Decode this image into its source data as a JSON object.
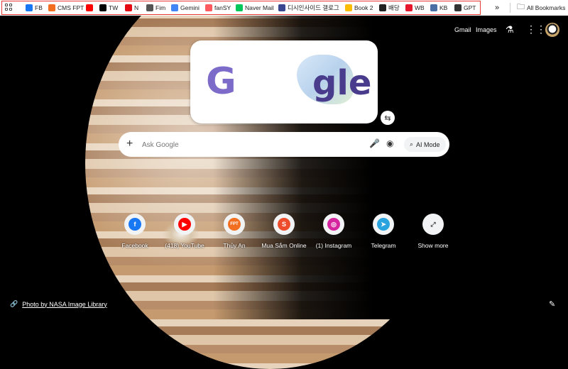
{
  "bookmarks": [
    {
      "label": "FB",
      "icon": "facebook-icon",
      "color": "#1877f2"
    },
    {
      "label": "CMS FPT",
      "icon": "fpt-icon",
      "color": "#f26f21"
    },
    {
      "label": "",
      "icon": "youtube-icon",
      "color": "#ff0000"
    },
    {
      "label": "TW",
      "icon": "x-icon",
      "color": "#000000"
    },
    {
      "label": "N",
      "icon": "netflix-icon",
      "color": "#e50914"
    },
    {
      "label": "Fim",
      "icon": "globe-icon",
      "color": "#555555"
    },
    {
      "label": "Gemini",
      "icon": "gemini-icon",
      "color": "#4285f4"
    },
    {
      "label": "fanSY",
      "icon": "fansy-icon",
      "color": "#ff5a5f"
    },
    {
      "label": "Naver Mail",
      "icon": "naver-icon",
      "color": "#03c75a"
    },
    {
      "label": "디시인사이드 갤로그",
      "icon": "dc-icon",
      "color": "#3b4890"
    },
    {
      "label": "Book 2",
      "icon": "drive-icon",
      "color": "#fbbc04"
    },
    {
      "label": "배당",
      "icon": "shield-icon",
      "color": "#222222"
    },
    {
      "label": "WB",
      "icon": "weibo-icon",
      "color": "#e6162d"
    },
    {
      "label": "KB",
      "icon": "kb-icon",
      "color": "#4a6fa5"
    },
    {
      "label": "GPT",
      "icon": "openai-icon",
      "color": "#333333"
    }
  ],
  "overflow_label": "»",
  "all_bookmarks": "All Bookmarks",
  "header": {
    "gmail": "Gmail",
    "images": "Images"
  },
  "search": {
    "placeholder": "Ask Google",
    "ai_mode": "AI Mode"
  },
  "shortcuts": [
    {
      "label": "Facebook",
      "icon": "facebook-icon",
      "color": "#1877f2",
      "glyph": "f"
    },
    {
      "label": "(418) YouTube",
      "icon": "youtube-icon",
      "color": "#ff0000",
      "glyph": "▶"
    },
    {
      "label": "Thủy An",
      "icon": "fpt-icon",
      "color": "#f26f21",
      "glyph": "FPT"
    },
    {
      "label": "Mua Sắm Online",
      "icon": "shopee-icon",
      "color": "#ee4d2d",
      "glyph": "S"
    },
    {
      "label": "(1) Instagram",
      "icon": "instagram-icon",
      "color": "#d6249f",
      "glyph": "◎"
    },
    {
      "label": "Telegram",
      "icon": "telegram-icon",
      "color": "#2aa3df",
      "glyph": "➤"
    },
    {
      "label": "Show more",
      "icon": "expand-icon",
      "color": "#444444",
      "glyph": "⤢"
    }
  ],
  "footer": {
    "credit": "Photo by NASA Image Library"
  }
}
